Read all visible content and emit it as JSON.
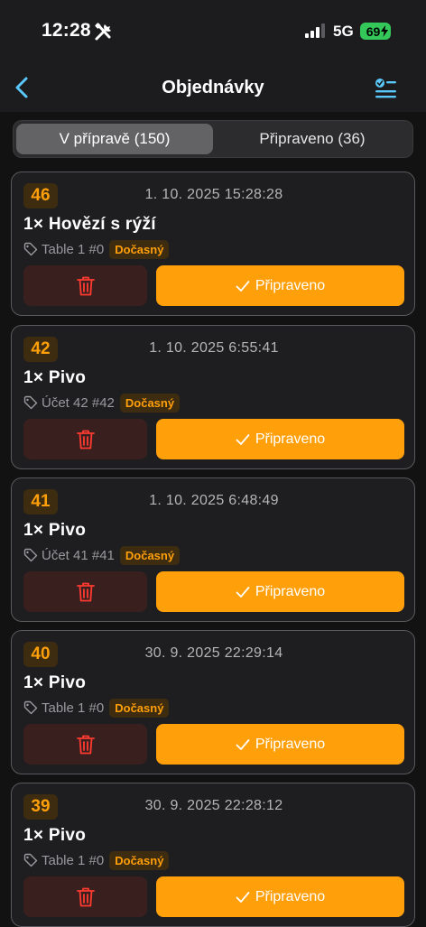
{
  "status_bar": {
    "time": "12:28",
    "network": "5G",
    "battery": "69"
  },
  "nav": {
    "title": "Objednávky"
  },
  "tabs": [
    {
      "label": "V přípravě (150)",
      "active": true
    },
    {
      "label": "Připraveno (36)",
      "active": false
    }
  ],
  "colors": {
    "accent": "#ff9f0a",
    "danger": "#ff3b30",
    "battery": "#34c759"
  },
  "orders": [
    {
      "number": "46",
      "time": "1. 10. 2025 15:28:28",
      "item": "1× Hovězí s rýží",
      "account": "Table 1 #0",
      "badge": "Dočasný",
      "ready_label": "Připraveno"
    },
    {
      "number": "42",
      "time": "1. 10. 2025 6:55:41",
      "item": "1× Pivo",
      "account": "Účet 42 #42",
      "badge": "Dočasný",
      "ready_label": "Připraveno"
    },
    {
      "number": "41",
      "time": "1. 10. 2025 6:48:49",
      "item": "1× Pivo",
      "account": "Účet 41 #41",
      "badge": "Dočasný",
      "ready_label": "Připraveno"
    },
    {
      "number": "40",
      "time": "30. 9. 2025 22:29:14",
      "item": "1× Pivo",
      "account": "Table 1 #0",
      "badge": "Dočasný",
      "ready_label": "Připraveno"
    },
    {
      "number": "39",
      "time": "30. 9. 2025 22:28:12",
      "item": "1× Pivo",
      "account": "Table 1 #0",
      "badge": "Dočasný",
      "ready_label": "Připraveno"
    }
  ]
}
